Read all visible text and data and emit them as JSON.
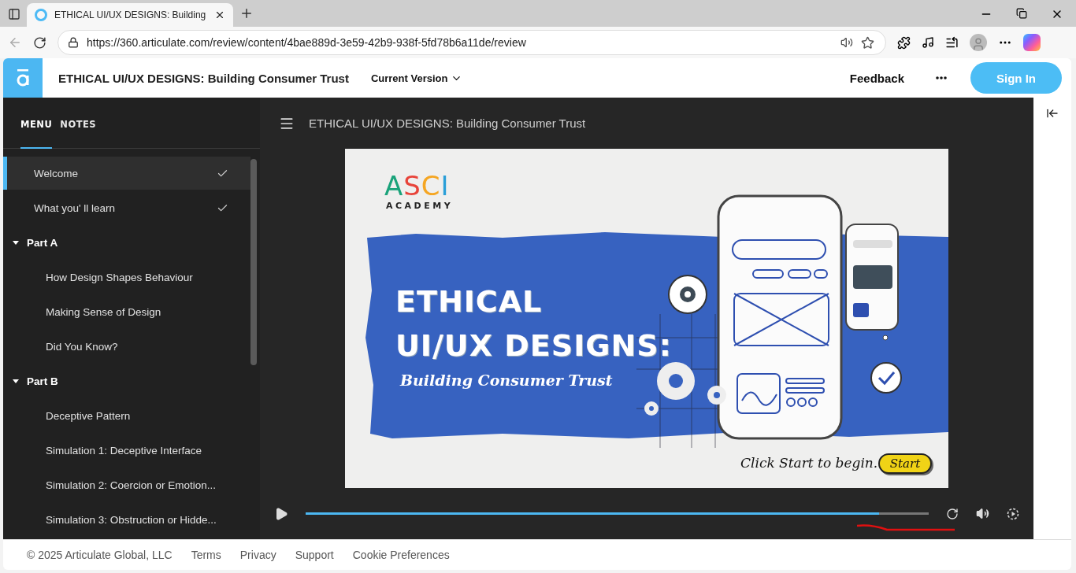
{
  "browser": {
    "tab_title": "ETHICAL UI/UX DESIGNS: Building",
    "url": "https://360.articulate.com/review/content/4bae889d-3e59-42b9-938f-5fd78b6a11de/review"
  },
  "header": {
    "title": "ETHICAL UI/UX DESIGNS: Building Consumer Trust",
    "version": "Current Version",
    "feedback": "Feedback",
    "sign_in": "Sign In"
  },
  "sidebar": {
    "tabs": [
      {
        "label": "MENU",
        "selected": true
      },
      {
        "label": "NOTES",
        "selected": false
      }
    ],
    "items": [
      {
        "kind": "page",
        "label": "Welcome",
        "selected": true,
        "completed": true
      },
      {
        "kind": "page",
        "label": "What you' ll learn",
        "selected": false,
        "completed": true
      },
      {
        "kind": "section",
        "label": "Part A",
        "expanded": true,
        "children": [
          {
            "kind": "page",
            "label": "How Design Shapes Behaviour",
            "selected": false,
            "completed": false
          },
          {
            "kind": "page",
            "label": "Making Sense of Design",
            "selected": false,
            "completed": false
          },
          {
            "kind": "page",
            "label": "Did You Know?",
            "selected": false,
            "completed": false
          }
        ]
      },
      {
        "kind": "section",
        "label": "Part B",
        "expanded": true,
        "children": [
          {
            "kind": "page",
            "label": "Deceptive Pattern",
            "selected": false,
            "completed": false
          },
          {
            "kind": "page",
            "label": "Simulation 1: Deceptive Interface",
            "selected": false,
            "completed": false
          },
          {
            "kind": "page",
            "label": "Simulation 2: Coercion or Emotion...",
            "selected": false,
            "completed": false
          },
          {
            "kind": "page",
            "label": "Simulation 3: Obstruction or Hidde...",
            "selected": false,
            "completed": false
          }
        ]
      }
    ]
  },
  "player": {
    "title": "ETHICAL UI/UX DESIGNS: Building Consumer Trust",
    "slide": {
      "logo_top": "ASCI",
      "logo_bottom": "ACADEMY",
      "heading_lines": [
        "ETHICAL",
        "UI/UX DESIGNS:"
      ],
      "subtitle": "Building Consumer Trust",
      "prompt": "Click Start to begin.",
      "start": "Start"
    },
    "progress": {
      "level": 0.92
    }
  },
  "footer": {
    "copyright": "© 2025 Articulate Global, LLC",
    "links": [
      "Terms",
      "Privacy",
      "Support",
      "Cookie Preferences"
    ]
  }
}
